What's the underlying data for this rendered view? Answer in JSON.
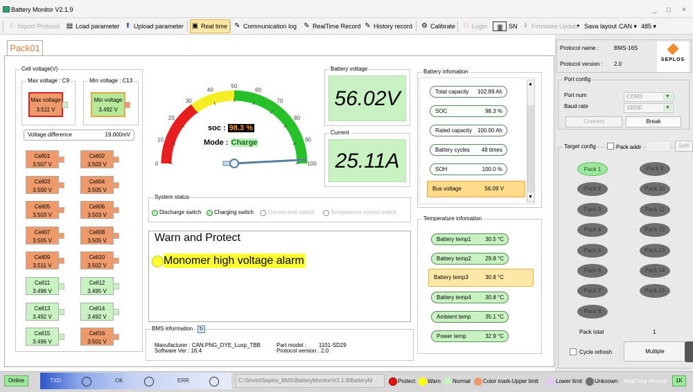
{
  "window": {
    "title": "Battery Monitor V2.1.9",
    "controls": [
      "_",
      "□",
      "×"
    ]
  },
  "toolbar": {
    "items": [
      {
        "label": "Import Protocol",
        "icon": "import-icon",
        "disabled": true
      },
      {
        "label": "Load parameter",
        "icon": "load-icon"
      },
      {
        "label": "Upload parameter",
        "icon": "upload-icon"
      },
      {
        "label": "Real time",
        "icon": "realtime-icon",
        "active": true
      },
      {
        "label": "Communication log",
        "icon": "log-icon"
      },
      {
        "label": "RealTime Record",
        "icon": "record-icon"
      },
      {
        "label": "History record",
        "icon": "history-icon"
      },
      {
        "label": "Calibrate",
        "icon": "calibrate-icon"
      },
      {
        "label": "Login",
        "icon": "login-icon",
        "disabled": true
      },
      {
        "label": "SN",
        "icon": "barcode-icon"
      },
      {
        "label": "Firmware Update",
        "icon": "firmware-icon",
        "disabled": true
      },
      {
        "label": "Sava layout",
        "icon": "save-icon"
      },
      {
        "label": "CAN",
        "icon": "dropdown"
      },
      {
        "label": "485",
        "icon": "dropdown"
      }
    ]
  },
  "tab": {
    "label": "Pack01"
  },
  "cell_voltage": {
    "legend": "Cell voltage(V)",
    "max_label": "Max voltage : C9",
    "min_label": "Min voltage : C13",
    "max_name": "Max voltage",
    "max_value": "3.511 V",
    "min_name": "Min voltage",
    "min_value": "3.492 V",
    "diff_label": "Voltage difference",
    "diff_value": "19.000mV",
    "cells": [
      {
        "name": "Cell01",
        "value": "3.507 V",
        "state": "upper"
      },
      {
        "name": "Cell02",
        "value": "3.503 V",
        "state": "upper"
      },
      {
        "name": "Cell03",
        "value": "3.500 V",
        "state": "upper"
      },
      {
        "name": "Cell04",
        "value": "3.505 V",
        "state": "upper"
      },
      {
        "name": "Cell05",
        "value": "3.503 V",
        "state": "upper"
      },
      {
        "name": "Cell06",
        "value": "3.503 V",
        "state": "upper"
      },
      {
        "name": "Cell07",
        "value": "3.505 V",
        "state": "upper"
      },
      {
        "name": "Cell08",
        "value": "3.505 V",
        "state": "upper"
      },
      {
        "name": "Cell09",
        "value": "3.511 V",
        "state": "upper"
      },
      {
        "name": "Cell10",
        "value": "3.502 V",
        "state": "upper"
      },
      {
        "name": "Cell11",
        "value": "3.496 V",
        "state": "normal"
      },
      {
        "name": "Cell12",
        "value": "3.495 V",
        "state": "normal"
      },
      {
        "name": "Cell13",
        "value": "3.492 V",
        "state": "normal"
      },
      {
        "name": "Cell14",
        "value": "3.492 V",
        "state": "normal"
      },
      {
        "name": "Cell15",
        "value": "3.496 V",
        "state": "normal"
      },
      {
        "name": "Cell16",
        "value": "3.501 V",
        "state": "upper"
      }
    ]
  },
  "gauge": {
    "ticks": [
      "0",
      "10",
      "20",
      "30",
      "40",
      "50",
      "60",
      "70",
      "80",
      "90",
      "100"
    ],
    "soc_label": "soc :",
    "soc_value": "98.3 %",
    "mode_label": "Mode :",
    "mode_value": "Charge",
    "needle_value": 98.3
  },
  "battery_voltage": {
    "legend": "Battery voltage",
    "value": "56.02V"
  },
  "current": {
    "legend": "Current",
    "value": "25.11A"
  },
  "system_status": {
    "legend": "System status",
    "items": [
      {
        "label": "Discharge switch",
        "on": true
      },
      {
        "label": "Charging switch",
        "on": true
      },
      {
        "label": "Current limit switch",
        "on": false
      },
      {
        "label": "Temperature control switch",
        "on": false
      }
    ]
  },
  "warn": {
    "title": "Warn and Protect",
    "alarm": "Monomer high voltage alarm"
  },
  "bms_info": {
    "legend": "BMS information",
    "manufacturer_label": "Manufacturer :",
    "manufacturer": "CAN:PNG_DYE_Luxp_TBB",
    "software_label": "Software Ver :",
    "software": "16.4",
    "part_label": "Part model :",
    "part": "1101-SD29",
    "protocol_label": "Protocol version :",
    "protocol": "2.0"
  },
  "battery_info": {
    "legend": "Battery infomation",
    "items": [
      {
        "key": "Total capacity",
        "value": "102.89 Ah"
      },
      {
        "key": "SOC",
        "value": "98.3 %"
      },
      {
        "key": "Rated capacity",
        "value": "100.00 Ah"
      },
      {
        "key": "Battery cycles",
        "value": "48 times"
      },
      {
        "key": "SOH",
        "value": "100.0 %"
      },
      {
        "key": "Bus voltage",
        "value": "56.09 V"
      }
    ]
  },
  "temp_info": {
    "legend": "Temperature infomation",
    "items": [
      {
        "key": "Battery temp1",
        "value": "30.5 °C"
      },
      {
        "key": "Battery temp2",
        "value": "29.8 °C"
      },
      {
        "key": "Battery temp3",
        "value": "30.8 °C"
      },
      {
        "key": "Battery temp4",
        "value": "30.8 °C"
      },
      {
        "key": "Ambient temp",
        "value": "35.1 °C"
      },
      {
        "key": "Power temp",
        "value": "32.9 °C"
      }
    ]
  },
  "right_panel": {
    "protocol_name_label": "Protocol name :",
    "protocol_name": "BMS-16S",
    "protocol_version_label": "Protocol version :",
    "protocol_version": "2.0",
    "logo_text": "SEPLOS",
    "port_config_legend": "Port config",
    "port_num_label": "Port num",
    "port_num": "COM3",
    "baud_rate_label": "Baud rate",
    "baud_rate": "19200",
    "connect_label": "Connect",
    "break_label": "Break",
    "target_config_legend": "Target config",
    "pack_addr_label": "Pack addr",
    "settings_label": "Setti",
    "packs": [
      "Pack 1",
      "Pack 9",
      "Pack 2",
      "Pack 10",
      "Pack 3",
      "Pack 11",
      "Pack 4",
      "Pack 12",
      "Pack 5",
      "Pack 13",
      "Pack 6",
      "Pack 14",
      "Pack 7",
      "Pack 15",
      "Pack 8"
    ],
    "active_pack": "Pack 1",
    "pack_total_label": "Pack total",
    "pack_total": "1",
    "cycle_refresh_label": "Cycle refresh",
    "multiple_label": "Multiple"
  },
  "statusbar": {
    "online": "Online",
    "txd": "TXD",
    "ok": "OK",
    "err": "ERR",
    "path": "C:\\Shoto\\Seplos_BMS\\BatteryMonitor\\V2.1.9\\BatteryM",
    "legend": [
      {
        "label": "Protect",
        "color": "#e81010"
      },
      {
        "label": "Warn",
        "color": "#ffff00"
      },
      {
        "label": "Normal",
        "color": "#c9f2c3"
      },
      {
        "label": "Color mark-Upper limit",
        "color": "#ef9a6a"
      },
      {
        "label": "Lower limit",
        "color": "#e3c9ef"
      },
      {
        "label": "Unknown",
        "color": "#6f6f6f"
      }
    ],
    "realtime_record": "RealTime Record",
    "record_count": "1K"
  }
}
